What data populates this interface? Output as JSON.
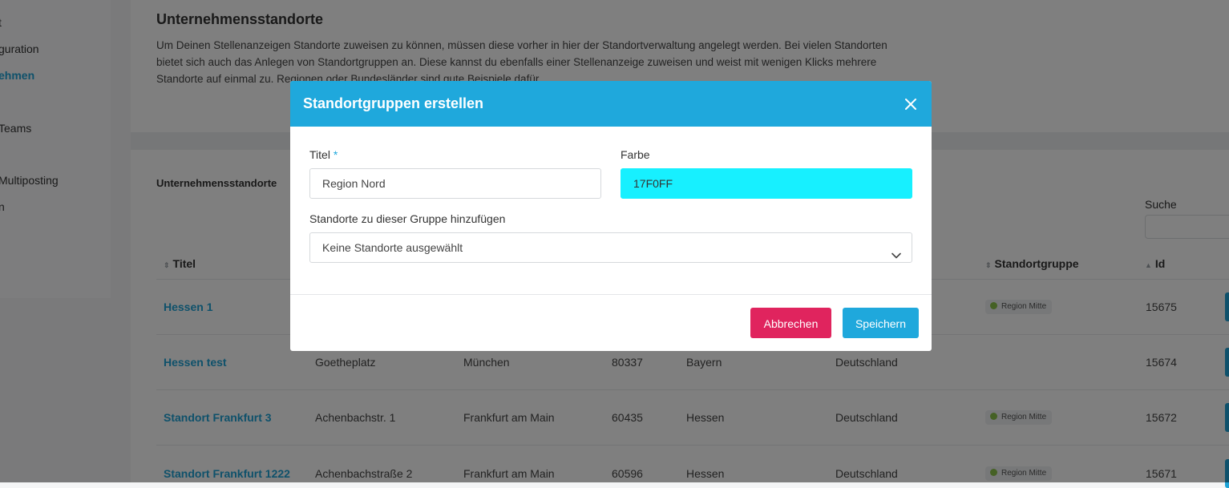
{
  "sidebar": {
    "items": [
      {
        "label": "t"
      },
      {
        "label": "guration"
      },
      {
        "label": "ehmen"
      },
      {
        "label": "Teams"
      },
      {
        "label": "Multiposting"
      },
      {
        "label": "n"
      }
    ]
  },
  "page": {
    "title": "Unternehmensstandorte",
    "description": "Um Deinen Stellenanzeigen Standorte zuweisen zu können, müssen diese vorher in hier der Standortverwaltung angelegt werden. Bei vielen Standorten bietet sich auch das Anlegen von Standortgruppen an. Diese kannst du ebenfalls einer Stellenanzeige zuweisen und weist mit wenigen Klicks mehrere Standorte auf einmal zu. Regionen oder Bundesländer sind gute Beispiele dafür.",
    "section_label": "Unternehmensstandorte",
    "search_label": "Suche"
  },
  "table": {
    "headers": {
      "title": "Titel",
      "group": "Standortgruppe",
      "id": "Id"
    },
    "rows": [
      {
        "title": "Hessen 1",
        "street": "",
        "city": "",
        "zip": "",
        "state": "",
        "country": "",
        "group": "Region Mitte",
        "id": "15675"
      },
      {
        "title": "Hessen test",
        "street": "Goetheplatz",
        "city": "München",
        "zip": "80337",
        "state": "Bayern",
        "country": "Deutschland",
        "group": "",
        "id": "15674"
      },
      {
        "title": "Standort Frankfurt 3",
        "street": "Achenbachstr. 1",
        "city": "Frankfurt am Main",
        "zip": "60435",
        "state": "Hessen",
        "country": "Deutschland",
        "group": "Region Mitte",
        "id": "15672"
      },
      {
        "title": "Standort Frankfurt 1222",
        "street": "Achenbachstraße 2",
        "city": "Frankfurt am Main",
        "zip": "60596",
        "state": "Hessen",
        "country": "Deutschland",
        "group": "Region Mitte",
        "id": "15671"
      }
    ]
  },
  "modal": {
    "title": "Standortgruppen erstellen",
    "close_icon": "close-icon",
    "title_field": {
      "label": "Titel",
      "required_mark": "*",
      "value": "Region Nord"
    },
    "color_field": {
      "label": "Farbe",
      "value": "17F0FF",
      "color": "#17F0FF"
    },
    "locations_field": {
      "label": "Standorte zu dieser Gruppe hinzufügen",
      "value": "Keine Standorte ausgewählt"
    },
    "cancel_label": "Abbrechen",
    "save_label": "Speichern"
  },
  "colors": {
    "accent": "#1FA8DC",
    "danger": "#E0245E",
    "badge_dot": "#8BC34A"
  }
}
